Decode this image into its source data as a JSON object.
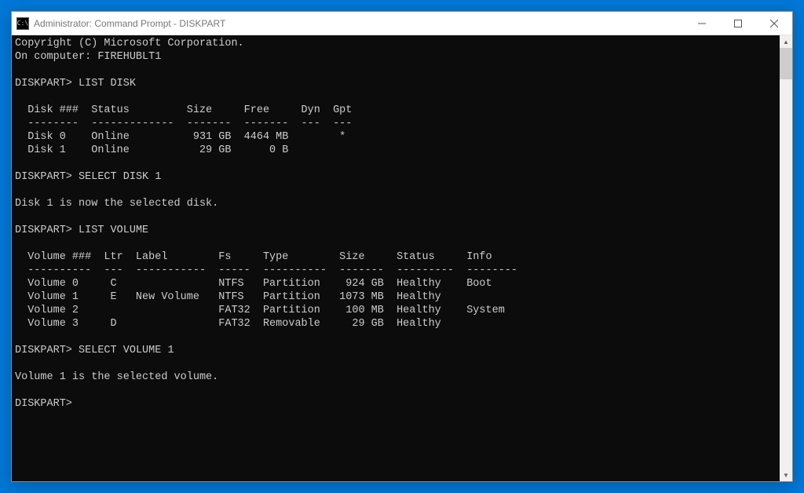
{
  "window": {
    "title": "Administrator: Command Prompt - DISKPART",
    "icon_label": "C:\\"
  },
  "terminal": {
    "intro": {
      "copyright": "Copyright (C) Microsoft Corporation.",
      "computer_line": "On computer: FIREHUBLT1"
    },
    "prompt": "DISKPART>",
    "commands": {
      "c1": "LIST DISK",
      "c2": "SELECT DISK 1",
      "c3": "LIST VOLUME",
      "c4": "SELECT VOLUME 1"
    },
    "disk_table": {
      "header": "  Disk ###  Status         Size     Free     Dyn  Gpt",
      "divider": "  --------  -------------  -------  -------  ---  ---",
      "rows": [
        "  Disk 0    Online          931 GB  4464 MB        *",
        "  Disk 1    Online           29 GB      0 B"
      ],
      "data": [
        {
          "disk": "Disk 0",
          "status": "Online",
          "size": "931 GB",
          "free": "4464 MB",
          "dyn": "",
          "gpt": "*"
        },
        {
          "disk": "Disk 1",
          "status": "Online",
          "size": "29 GB",
          "free": "0 B",
          "dyn": "",
          "gpt": ""
        }
      ]
    },
    "select_disk_msg": "Disk 1 is now the selected disk.",
    "volume_table": {
      "header": "  Volume ###  Ltr  Label        Fs     Type        Size     Status     Info",
      "divider": "  ----------  ---  -----------  -----  ----------  -------  ---------  --------",
      "rows": [
        "  Volume 0     C                NTFS   Partition    924 GB  Healthy    Boot",
        "  Volume 1     E   New Volume   NTFS   Partition   1073 MB  Healthy",
        "  Volume 2                      FAT32  Partition    100 MB  Healthy    System",
        "  Volume 3     D                FAT32  Removable     29 GB  Healthy"
      ],
      "data": [
        {
          "volume": "Volume 0",
          "ltr": "C",
          "label": "",
          "fs": "NTFS",
          "type": "Partition",
          "size": "924 GB",
          "status": "Healthy",
          "info": "Boot"
        },
        {
          "volume": "Volume 1",
          "ltr": "E",
          "label": "New Volume",
          "fs": "NTFS",
          "type": "Partition",
          "size": "1073 MB",
          "status": "Healthy",
          "info": ""
        },
        {
          "volume": "Volume 2",
          "ltr": "",
          "label": "",
          "fs": "FAT32",
          "type": "Partition",
          "size": "100 MB",
          "status": "Healthy",
          "info": "System"
        },
        {
          "volume": "Volume 3",
          "ltr": "D",
          "label": "",
          "fs": "FAT32",
          "type": "Removable",
          "size": "29 GB",
          "status": "Healthy",
          "info": ""
        }
      ]
    },
    "select_volume_msg": "Volume 1 is the selected volume."
  }
}
